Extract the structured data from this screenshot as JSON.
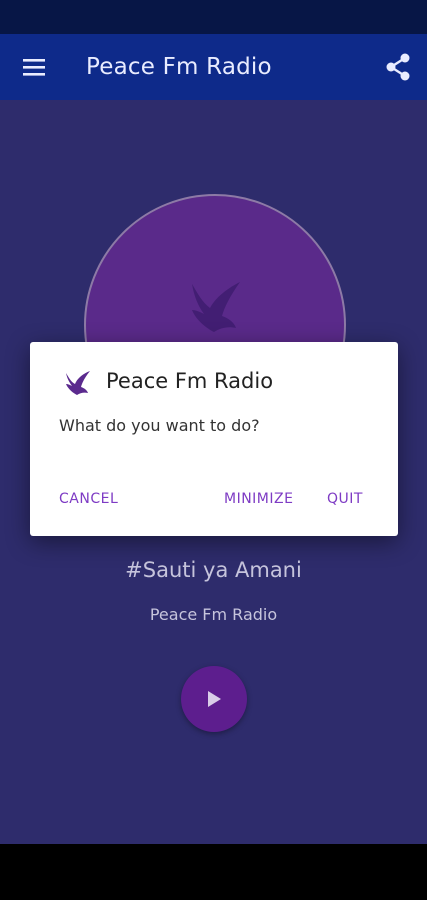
{
  "app_bar": {
    "title": "Peace Fm Radio",
    "menu_icon": "hamburger-menu-icon",
    "share_icon": "share-icon"
  },
  "player": {
    "tagline": "#Sauti ya Amani",
    "station_name": "Peace Fm Radio",
    "play_icon": "play-icon"
  },
  "dialog": {
    "title": "Peace Fm Radio",
    "message": "What do you want to do?",
    "buttons": {
      "cancel": "CANCEL",
      "minimize": "MINIMIZE",
      "quit": "QUIT"
    },
    "icon": "dove-icon"
  },
  "colors": {
    "app_bar": "#0e2a8a",
    "background": "#2e2c6c",
    "accent": "#7e3bc4",
    "play_button": "#5d1e8e"
  }
}
